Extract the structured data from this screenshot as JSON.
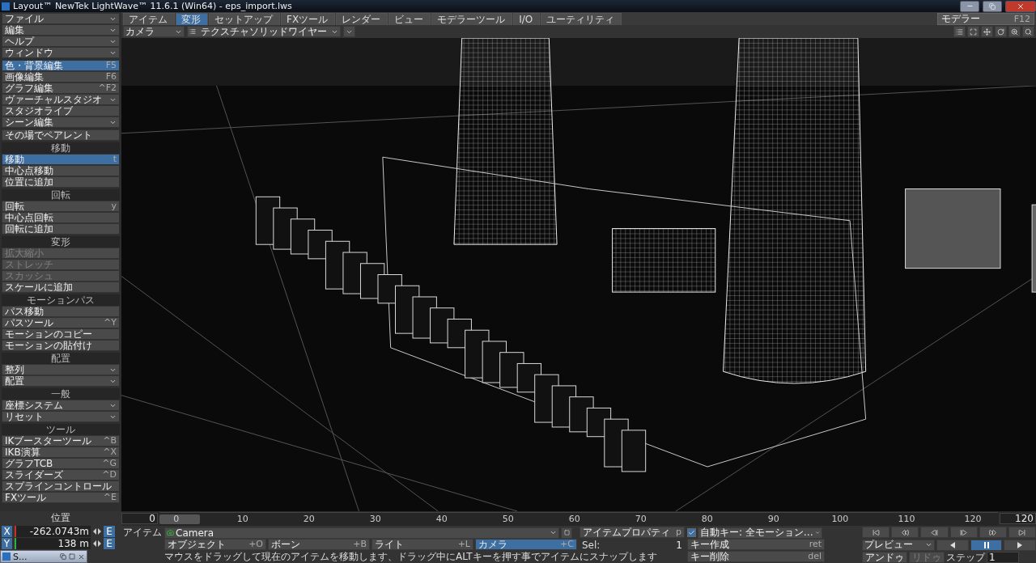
{
  "window": {
    "title": "Layout™ NewTek LightWave™ 11.6.1 (Win64) - eps_import.lws"
  },
  "tabs": [
    {
      "label": "アイテム",
      "selected": false
    },
    {
      "label": "変形",
      "selected": true
    },
    {
      "label": "セットアップ",
      "selected": false
    },
    {
      "label": "FXツール",
      "selected": false
    },
    {
      "label": "レンダー",
      "selected": false
    },
    {
      "label": "ビュー",
      "selected": false
    },
    {
      "label": "モデラーツール",
      "selected": false
    },
    {
      "label": "I/O",
      "selected": false
    },
    {
      "label": "ユーティリティ",
      "selected": false
    }
  ],
  "modeler_button": {
    "label": "モデラー",
    "shortcut": "F12"
  },
  "viewport_bar": {
    "camera": "カメラ",
    "render_mode": "テクスチャソリッドワイヤー"
  },
  "sidebar": [
    {
      "items": [
        {
          "label": "ファイル",
          "kind": "menu",
          "selected": false,
          "disabled": false
        },
        {
          "label": "編集",
          "kind": "menu",
          "selected": false,
          "disabled": false
        },
        {
          "label": "ヘルプ",
          "kind": "menu",
          "selected": false,
          "disabled": false
        },
        {
          "label": "ウィンドウ",
          "kind": "menu",
          "selected": false,
          "disabled": false
        }
      ]
    },
    {
      "items": [
        {
          "label": "色・背景編集",
          "shortcut": "F5",
          "kind": "button",
          "selected": true,
          "disabled": false
        },
        {
          "label": "画像編集",
          "shortcut": "F6",
          "kind": "button",
          "selected": false,
          "disabled": false
        },
        {
          "label": "グラフ編集",
          "shortcut": "^F2",
          "kind": "button",
          "selected": false,
          "disabled": false
        },
        {
          "label": "ヴァーチャルスタジオ",
          "kind": "menu",
          "selected": false,
          "disabled": false
        },
        {
          "label": "スタジオライブ",
          "kind": "button",
          "selected": false,
          "disabled": false
        },
        {
          "label": "シーン編集",
          "kind": "menu",
          "selected": false,
          "disabled": false
        }
      ]
    },
    {
      "items": [
        {
          "label": "その場でペアレント",
          "kind": "button",
          "selected": false,
          "disabled": false
        }
      ]
    },
    {
      "title": "移動",
      "items": [
        {
          "label": "移動",
          "shortcut": "t",
          "kind": "button",
          "selected": true,
          "disabled": false
        },
        {
          "label": "中心点移動",
          "kind": "button",
          "selected": false,
          "disabled": false
        },
        {
          "label": "位置に追加",
          "kind": "button",
          "selected": false,
          "disabled": false
        }
      ]
    },
    {
      "title": "回転",
      "items": [
        {
          "label": "回転",
          "shortcut": "y",
          "kind": "button",
          "selected": false,
          "disabled": false
        },
        {
          "label": "中心点回転",
          "kind": "button",
          "selected": false,
          "disabled": false
        },
        {
          "label": "回転に追加",
          "kind": "button",
          "selected": false,
          "disabled": false
        }
      ]
    },
    {
      "title": "変形",
      "items": [
        {
          "label": "拡大縮小",
          "kind": "button",
          "selected": false,
          "disabled": true
        },
        {
          "label": "ストレッチ",
          "kind": "button",
          "selected": false,
          "disabled": true
        },
        {
          "label": "スカッシュ",
          "kind": "button",
          "selected": false,
          "disabled": true
        },
        {
          "label": "スケールに追加",
          "kind": "button",
          "selected": false,
          "disabled": false
        }
      ]
    },
    {
      "title": "モーションパス",
      "items": [
        {
          "label": "パス移動",
          "kind": "button",
          "selected": false,
          "disabled": false
        },
        {
          "label": "パスツール",
          "shortcut": "^Y",
          "kind": "button",
          "selected": false,
          "disabled": false
        },
        {
          "label": "モーションのコピー",
          "kind": "button",
          "selected": false,
          "disabled": false
        },
        {
          "label": "モーションの貼付け",
          "kind": "button",
          "selected": false,
          "disabled": false
        }
      ]
    },
    {
      "title": "配置",
      "items": [
        {
          "label": "整列",
          "kind": "menu",
          "selected": false,
          "disabled": false
        },
        {
          "label": "配置",
          "kind": "menu",
          "selected": false,
          "disabled": false
        }
      ]
    },
    {
      "title": "一般",
      "items": [
        {
          "label": "座標システム",
          "kind": "menu",
          "selected": false,
          "disabled": false
        },
        {
          "label": "リセット",
          "kind": "menu",
          "selected": false,
          "disabled": false
        }
      ]
    },
    {
      "title": "ツール",
      "items": [
        {
          "label": "IKブースターツール",
          "shortcut": "^B",
          "kind": "button",
          "selected": false,
          "disabled": false
        },
        {
          "label": "IKB演算",
          "shortcut": "^X",
          "kind": "button",
          "selected": false,
          "disabled": false
        },
        {
          "label": "グラフTCB",
          "shortcut": "^G",
          "kind": "button",
          "selected": false,
          "disabled": false
        },
        {
          "label": "スライダーズ",
          "shortcut": "^D",
          "kind": "button",
          "selected": false,
          "disabled": false
        },
        {
          "label": "スプラインコントロール",
          "kind": "button",
          "selected": false,
          "disabled": false
        },
        {
          "label": "FXツール",
          "shortcut": "^E",
          "kind": "button",
          "selected": false,
          "disabled": false
        }
      ]
    }
  ],
  "position": {
    "title": "位置",
    "axes": [
      {
        "axis": "X",
        "value": "-262.0743m",
        "color": "#c83030",
        "edit": "E"
      },
      {
        "axis": "Y",
        "value": "138 m",
        "color": "#30b040",
        "edit": "E"
      }
    ]
  },
  "timeline": {
    "current": "0",
    "end": "120",
    "ticks": [
      "0",
      "10",
      "20",
      "30",
      "40",
      "50",
      "60",
      "70",
      "80",
      "90",
      "100",
      "110",
      "120"
    ]
  },
  "item_row": {
    "label": "アイテム",
    "current": "Camera",
    "properties": "アイテムプロパティ",
    "properties_shortcut": "p"
  },
  "auto_key": {
    "checked": true,
    "label": "自動キー: 全モーション…"
  },
  "item_types": [
    {
      "label": "オブジェクト",
      "shortcut": "+O",
      "selected": false
    },
    {
      "label": "ボーン",
      "shortcut": "+B",
      "selected": false
    },
    {
      "label": "ライト",
      "shortcut": "+L",
      "selected": false
    },
    {
      "label": "カメラ",
      "shortcut": "+C",
      "selected": true
    }
  ],
  "sel": {
    "label": "Sel:",
    "value": "1"
  },
  "key_buttons": [
    {
      "label": "キー作成",
      "shortcut": "ret"
    },
    {
      "label": "キー削除",
      "shortcut": "del"
    }
  ],
  "status": "マウスをドラッグして現在のアイテムを移動します、ドラッグ中にALTキーを押す事でアイテムにスナップします",
  "preview": "プレビュー",
  "play_buttons": [
    {
      "kind": "reverse",
      "selected": false
    },
    {
      "kind": "pause",
      "selected": true
    },
    {
      "kind": "play",
      "selected": false
    }
  ],
  "undo": {
    "label": "アンドゥ",
    "disabled": false
  },
  "redo": {
    "label": "リドゥ",
    "disabled": true
  },
  "step": {
    "label": "ステップ",
    "value": "1"
  },
  "taskbar_window": {
    "title": "S..."
  }
}
